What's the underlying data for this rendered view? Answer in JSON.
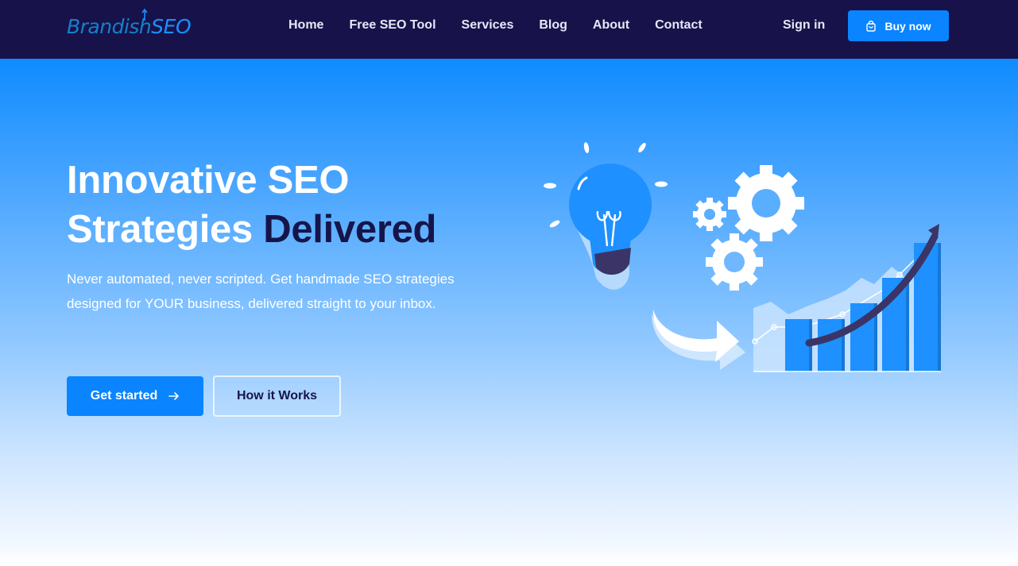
{
  "brand": {
    "logo_text_1": "Brandish",
    "logo_text_2": "SEO"
  },
  "nav": {
    "links": [
      "Home",
      "Free SEO Tool",
      "Services",
      "Blog",
      "About",
      "Contact"
    ],
    "signin": "Sign in",
    "buy": "Buy now"
  },
  "hero": {
    "title_line1": "Innovative SEO",
    "title_line2_a": "Strategies ",
    "title_line2_b": "Delivered",
    "description": "Never automated, never scripted. Get handmade SEO strategies designed for YOUR business, delivered straight to your inbox.",
    "cta_primary": "Get started",
    "cta_secondary": "How it Works"
  },
  "colors": {
    "navbar": "#17124a",
    "accent": "#0a84ff",
    "title_dark": "#16154a"
  },
  "icons": {
    "buy": "shopping-bag-icon",
    "cta_primary": "arrow-right-icon"
  }
}
